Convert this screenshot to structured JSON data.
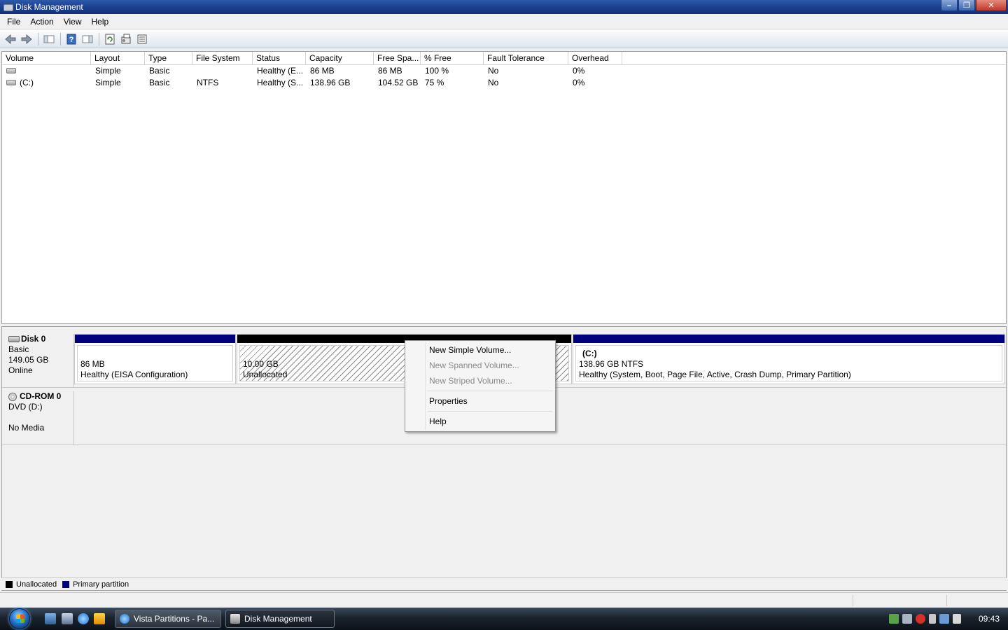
{
  "window": {
    "title": "Disk Management",
    "controls": {
      "minimize": "–",
      "restore": "❐",
      "close": "✕"
    }
  },
  "menu": [
    "File",
    "Action",
    "View",
    "Help"
  ],
  "toolbar": {
    "icons": [
      "back-icon",
      "forward-icon",
      "show-hide-console-tree-icon",
      "help-icon",
      "action-pane-icon",
      "refresh-icon",
      "properties-icon",
      "export-list-icon"
    ]
  },
  "volume_list": {
    "columns": [
      "Volume",
      "Layout",
      "Type",
      "File System",
      "Status",
      "Capacity",
      "Free Spa...",
      "% Free",
      "Fault Tolerance",
      "Overhead"
    ],
    "rows": [
      {
        "volume": "",
        "layout": "Simple",
        "type": "Basic",
        "fs": "",
        "status": "Healthy (E...",
        "capacity": "86 MB",
        "free": "86 MB",
        "pct": "100 %",
        "fault": "No",
        "overhead": "0%"
      },
      {
        "volume": "(C:)",
        "layout": "Simple",
        "type": "Basic",
        "fs": "NTFS",
        "status": "Healthy (S...",
        "capacity": "138.96 GB",
        "free": "104.52 GB",
        "pct": "75 %",
        "fault": "No",
        "overhead": "0%"
      }
    ]
  },
  "disks": [
    {
      "name": "Disk 0",
      "type": "Basic",
      "size": "149.05 GB",
      "state": "Online",
      "partitions": [
        {
          "kind": "primary",
          "name": "",
          "size": "86 MB",
          "status": "Healthy (EISA Configuration)"
        },
        {
          "kind": "unallocated",
          "name": "",
          "size": "10.00 GB",
          "status": "Unallocated"
        },
        {
          "kind": "primary",
          "name": "(C:)",
          "size": "138.96 GB NTFS",
          "status": "Healthy (System, Boot, Page File, Active, Crash Dump, Primary Partition)"
        }
      ]
    },
    {
      "name": "CD-ROM 0",
      "type": "DVD (D:)",
      "size": "",
      "state": "No Media"
    }
  ],
  "legend": {
    "unallocated": "Unallocated",
    "primary": "Primary partition",
    "colors": {
      "unallocated": "#000000",
      "primary": "#00007f"
    }
  },
  "context_menu": {
    "items": [
      {
        "label": "New Simple Volume...",
        "enabled": true
      },
      {
        "label": "New Spanned Volume...",
        "enabled": false
      },
      {
        "label": "New Striped Volume...",
        "enabled": false
      },
      {
        "label": "Properties",
        "enabled": true
      },
      {
        "label": "Help",
        "enabled": true
      }
    ]
  },
  "taskbar": {
    "buttons": [
      "Vista Partitions - Pa...",
      "Disk Management"
    ],
    "clock": "09:43"
  }
}
